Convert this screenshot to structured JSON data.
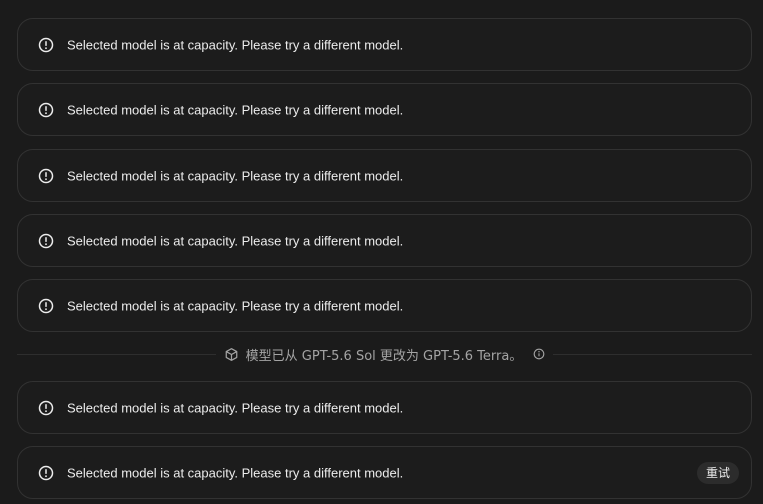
{
  "messages": [
    {
      "text": "Selected model is at capacity. Please try a different model.",
      "icon": "alert-circle-icon"
    },
    {
      "text": "Selected model is at capacity. Please try a different model.",
      "icon": "alert-circle-icon"
    },
    {
      "text": "Selected model is at capacity. Please try a different model.",
      "icon": "alert-circle-icon"
    },
    {
      "text": "Selected model is at capacity. Please try a different model.",
      "icon": "alert-circle-icon"
    },
    {
      "text": "Selected model is at capacity. Please try a different model.",
      "icon": "alert-circle-icon"
    },
    {
      "text": "Selected model is at capacity. Please try a different model.",
      "icon": "alert-circle-icon"
    },
    {
      "text": "Selected model is at capacity. Please try a different model.",
      "icon": "alert-circle-icon"
    }
  ],
  "model_switch": {
    "text": "模型已从 GPT-5.6 Sol 更改为 GPT-5.6 Terra。",
    "icon": "cube-icon",
    "info_icon": "info-icon"
  },
  "retry_label": "重试",
  "colors": {
    "background": "#1b1b1b",
    "card_border": "#323232",
    "text": "#ececec",
    "muted_text": "#a4a4a4"
  }
}
